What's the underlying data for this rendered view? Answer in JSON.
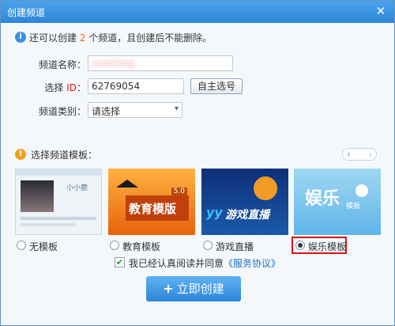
{
  "window": {
    "title": "创建频道",
    "close_glyph": "✕"
  },
  "notice": {
    "prefix": "还可以创建 ",
    "count": "2",
    "suffix": " 个频道，且创建后不能删除。"
  },
  "form": {
    "name_label": "频道名称：",
    "name_value": "coaching",
    "id_label_prefix": "选择 ",
    "id_label_id": "ID",
    "id_label_suffix": "：",
    "id_value": "62769054",
    "auto_select_label": "自主选号",
    "category_label": "频道类别：",
    "category_value": "请选择"
  },
  "templates": {
    "section_title": "选择频道模板：",
    "nav": {
      "prev": "‹",
      "next": "›"
    },
    "items": [
      {
        "label": "无模板",
        "checked": false,
        "thumb_text": "小小鹿"
      },
      {
        "label": "教育模板",
        "checked": false,
        "thumb_text": "教育模版",
        "badge": "5.0"
      },
      {
        "label": "游戏直播",
        "checked": false,
        "thumb_text": "游戏直播",
        "brand": "yy"
      },
      {
        "label": "娱乐模板",
        "checked": true,
        "thumb_text": "娱乐",
        "thumb_sub": "模板"
      }
    ]
  },
  "agreement": {
    "text": "我已经认真阅读并同意",
    "link": "《服务协议》",
    "checked": true
  },
  "create_button": {
    "label": "立即创建",
    "icon": "+"
  },
  "colors": {
    "accent": "#2c86d8",
    "count_orange": "#ff6600",
    "highlight_red": "#d4131c",
    "link_blue": "#1a6fc7"
  }
}
